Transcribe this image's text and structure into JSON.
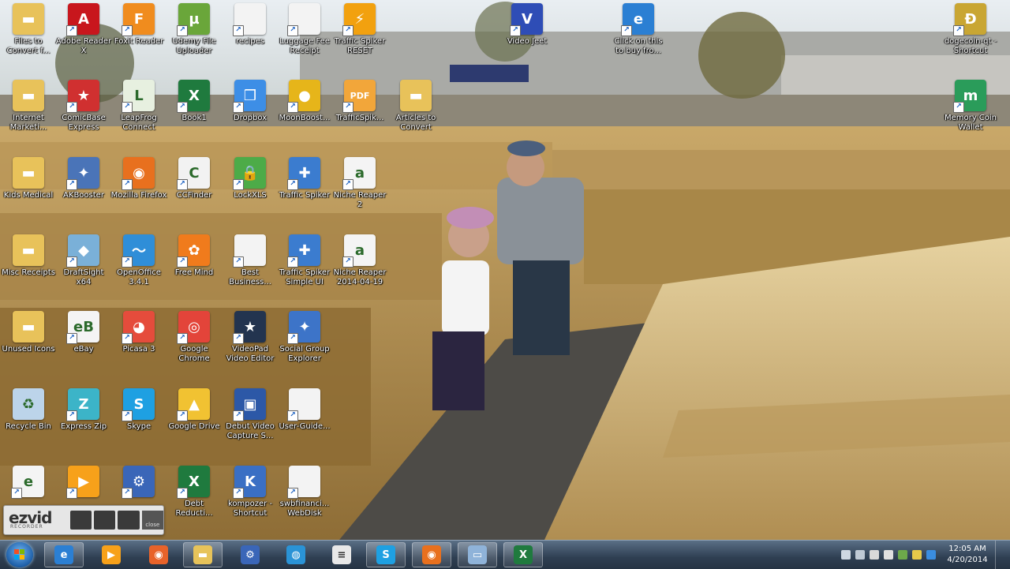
{
  "desktop": {
    "icons": [
      {
        "label": "Files to Convert f...",
        "icon": "folder-icon"
      },
      {
        "label": "Adobe Reader X",
        "icon": "adobe-reader-icon"
      },
      {
        "label": "Foxit Reader",
        "icon": "foxit-reader-icon"
      },
      {
        "label": "Udemy File Uploader",
        "icon": "utorrent-icon"
      },
      {
        "label": "recipes",
        "icon": "document-icon"
      },
      {
        "label": "Luggage Fee Receipt",
        "icon": "document-icon"
      },
      {
        "label": "Traffic Spiker RESET",
        "icon": "lightning-icon"
      },
      {
        "label": "Video Jeet",
        "icon": "video-jeet-icon"
      },
      {
        "label": "Click on this to buy fro...",
        "icon": "internet-explorer-icon"
      },
      {
        "label": "dogecoin-qt - Shortcut",
        "icon": "dogecoin-icon"
      },
      {
        "label": "Internet Marketi...",
        "icon": "folder-icon"
      },
      {
        "label": "ComicBase Express",
        "icon": "comicbase-icon"
      },
      {
        "label": "LeapFrog Connect",
        "icon": "leapfrog-icon"
      },
      {
        "label": "Book1",
        "icon": "excel-icon"
      },
      {
        "label": "Dropbox",
        "icon": "dropbox-icon"
      },
      {
        "label": "MoonBoost...",
        "icon": "coin-icon"
      },
      {
        "label": "TrafficSpik...",
        "icon": "pdf-icon"
      },
      {
        "label": "Articles to Convert",
        "icon": "folder-icon"
      },
      {
        "label": "Memory Coin Wallet",
        "icon": "memorycoin-icon"
      },
      {
        "label": "Kids Medical",
        "icon": "folder-icon"
      },
      {
        "label": "AKBooster",
        "icon": "wrench-icon"
      },
      {
        "label": "Mozilla Firefox",
        "icon": "firefox-icon"
      },
      {
        "label": "CCFinder",
        "icon": "ccfinder-icon"
      },
      {
        "label": "LockXLS",
        "icon": "lock-icon"
      },
      {
        "label": "Traffic Spiker",
        "icon": "traffic-spiker-icon"
      },
      {
        "label": "Niche Reaper 2",
        "icon": "excel-doc-icon"
      },
      {
        "label": "Misc Receipts",
        "icon": "folder-icon"
      },
      {
        "label": "DraftSight x64",
        "icon": "draftsight-icon"
      },
      {
        "label": "OpenOffice 3.4.1",
        "icon": "openoffice-icon"
      },
      {
        "label": "Free Mind",
        "icon": "butterfly-icon"
      },
      {
        "label": "Best Business...",
        "icon": "document-icon"
      },
      {
        "label": "Traffic Spiker Simple UI",
        "icon": "traffic-spiker-icon"
      },
      {
        "label": "Niche Reaper 2014-04-19",
        "icon": "excel-doc-icon"
      },
      {
        "label": "Unused Icons",
        "icon": "folder-icon"
      },
      {
        "label": "eBay",
        "icon": "ebay-icon"
      },
      {
        "label": "Picasa 3",
        "icon": "picasa-icon"
      },
      {
        "label": "Google Chrome",
        "icon": "chrome-icon"
      },
      {
        "label": "VideoPad Video Editor",
        "icon": "videopad-icon"
      },
      {
        "label": "Social Group Explorer",
        "icon": "social-group-icon"
      },
      {
        "label": "Recycle Bin",
        "icon": "recycle-bin-icon"
      },
      {
        "label": "Express Zip",
        "icon": "express-zip-icon"
      },
      {
        "label": "Skype",
        "icon": "skype-icon"
      },
      {
        "label": "Google Drive",
        "icon": "google-drive-icon"
      },
      {
        "label": "Debut Video Capture S...",
        "icon": "debut-video-icon"
      },
      {
        "label": "User-Guide...",
        "icon": "document-icon"
      },
      {
        "label": "",
        "icon": "internet-explorer-doc-icon"
      },
      {
        "label": "",
        "icon": "media-player-icon"
      },
      {
        "label": "",
        "icon": "network-icon"
      },
      {
        "label": "Debt Reducti...",
        "icon": "excel-icon"
      },
      {
        "label": "kompozer - Shortcut",
        "icon": "kompozer-icon"
      },
      {
        "label": "swbfinanci... WebDisk",
        "icon": "document-icon"
      }
    ]
  },
  "recorder": {
    "logo_text": "ezvid",
    "logo_sub": "RECORDER",
    "close_label": "close"
  },
  "taskbar": {
    "apps": [
      {
        "icon": "internet-explorer-icon",
        "pinned": true
      },
      {
        "icon": "media-player-icon",
        "pinned": false
      },
      {
        "icon": "ezvid-icon",
        "pinned": false
      },
      {
        "icon": "file-explorer-icon",
        "pinned": true
      },
      {
        "icon": "network-icon",
        "pinned": false
      },
      {
        "icon": "globe-icon",
        "pinned": false
      },
      {
        "icon": "notepad-icon",
        "pinned": false
      },
      {
        "icon": "skype-icon",
        "pinned": true
      },
      {
        "icon": "firefox-icon",
        "pinned": true
      },
      {
        "icon": "window-icon",
        "pinned": true
      },
      {
        "icon": "excel-icon",
        "pinned": true
      }
    ],
    "clock": {
      "time": "12:05 AM",
      "date": "4/20/2014"
    }
  }
}
